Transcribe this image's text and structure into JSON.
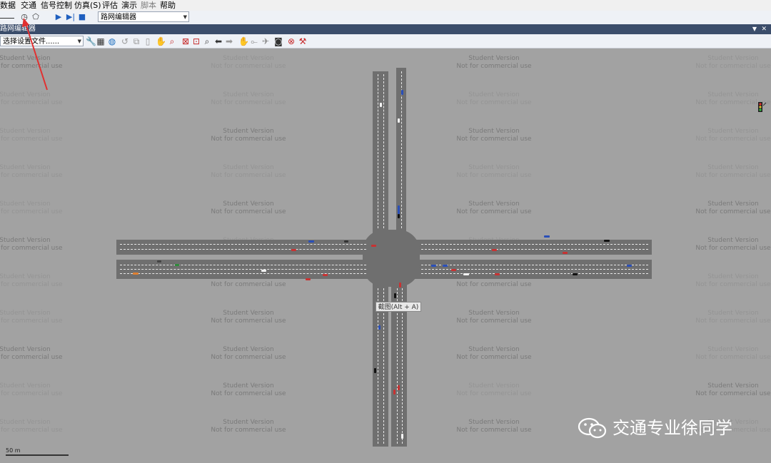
{
  "menu": {
    "items": [
      "数据",
      "交通",
      "信号控制",
      "仿真(S)",
      "评估",
      "演示",
      "脚本",
      "帮助"
    ],
    "disabled_index": 6
  },
  "toolbar": {
    "combo_value": "路网编辑器",
    "play_color": "#1f5fbf"
  },
  "panel": {
    "title": "路网编辑器",
    "pin": "▼ ✕",
    "close": "✕",
    "settings_combo": "选择设置文件......"
  },
  "canvas": {
    "watermark_line1": "Student Version",
    "watermark_line2": "Not for commercial use",
    "tooltip": "截图(Alt + A)",
    "scale_label": "50 m"
  },
  "brand": {
    "wechat_text": "交通专业徐同学"
  },
  "colors": {
    "road": "#6f6f6f",
    "background": "#a2a2a2",
    "vehicle_red": "#c83232",
    "vehicle_blue": "#2a4fb8",
    "vehicle_black": "#111111",
    "vehicle_white": "#f4f4f4",
    "arrow": "#e23030"
  }
}
